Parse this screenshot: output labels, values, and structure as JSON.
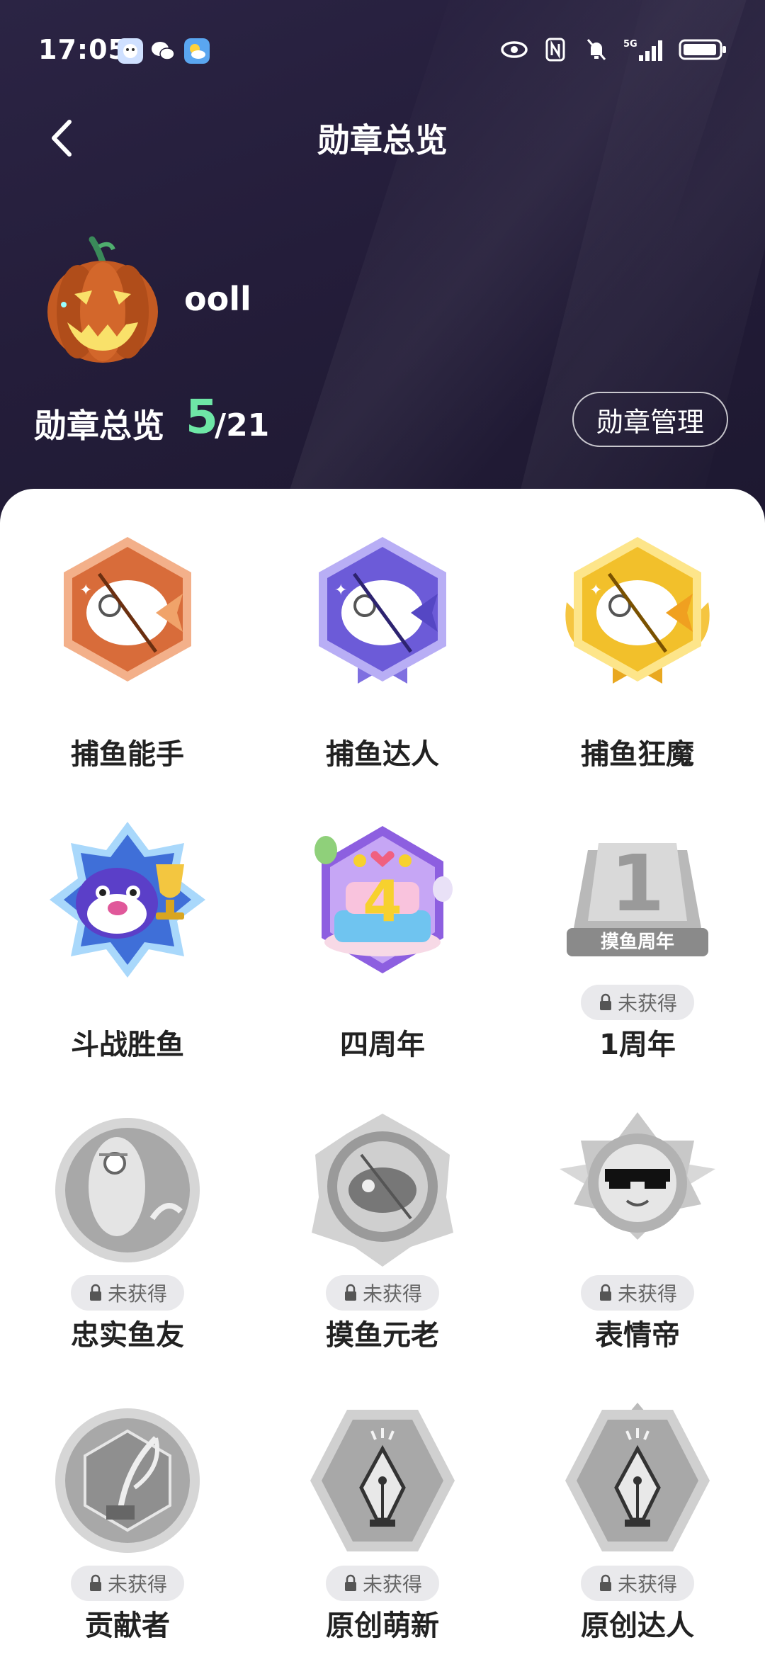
{
  "status_bar": {
    "time": "17:05",
    "icons": [
      "eye-icon",
      "nfc-icon",
      "mute-icon",
      "5g-signal-icon",
      "battery-icon"
    ],
    "app_icons": [
      "qq-icon",
      "wechat-icon",
      "weather-icon"
    ]
  },
  "nav": {
    "title": "勋章总览",
    "back_icon": "back-arrow-icon"
  },
  "profile": {
    "username": "ooll",
    "avatar_icon": "pumpkin-avatar"
  },
  "summary": {
    "label": "勋章总览",
    "earned": "5",
    "total": "/21",
    "manage_label": "勋章管理"
  },
  "lock_text": "未获得",
  "badges": [
    {
      "name": "捕鱼能手",
      "locked": false,
      "color": "#d86c3a"
    },
    {
      "name": "捕鱼达人",
      "locked": false,
      "color": "#6c5bd8"
    },
    {
      "name": "捕鱼狂魔",
      "locked": false,
      "color": "#f2c02b"
    },
    {
      "name": "斗战胜鱼",
      "locked": false,
      "color": "#3f6fd8"
    },
    {
      "name": "四周年",
      "locked": false,
      "color": "#8d5fe0"
    },
    {
      "name": "1周年",
      "locked": true,
      "color": "#9a9a9a",
      "caption": "摸鱼周年"
    },
    {
      "name": "忠实鱼友",
      "locked": true,
      "color": "#9a9a9a"
    },
    {
      "name": "摸鱼元老",
      "locked": true,
      "color": "#9a9a9a"
    },
    {
      "name": "表情帝",
      "locked": true,
      "color": "#9a9a9a"
    },
    {
      "name": "贡献者",
      "locked": true,
      "color": "#9a9a9a"
    },
    {
      "name": "原创萌新",
      "locked": true,
      "color": "#9a9a9a"
    },
    {
      "name": "原创达人",
      "locked": true,
      "color": "#9a9a9a"
    }
  ],
  "colors": {
    "header_bg": "#241d3a",
    "accent_green": "#6ee6a6",
    "panel_bg": "#ffffff"
  }
}
